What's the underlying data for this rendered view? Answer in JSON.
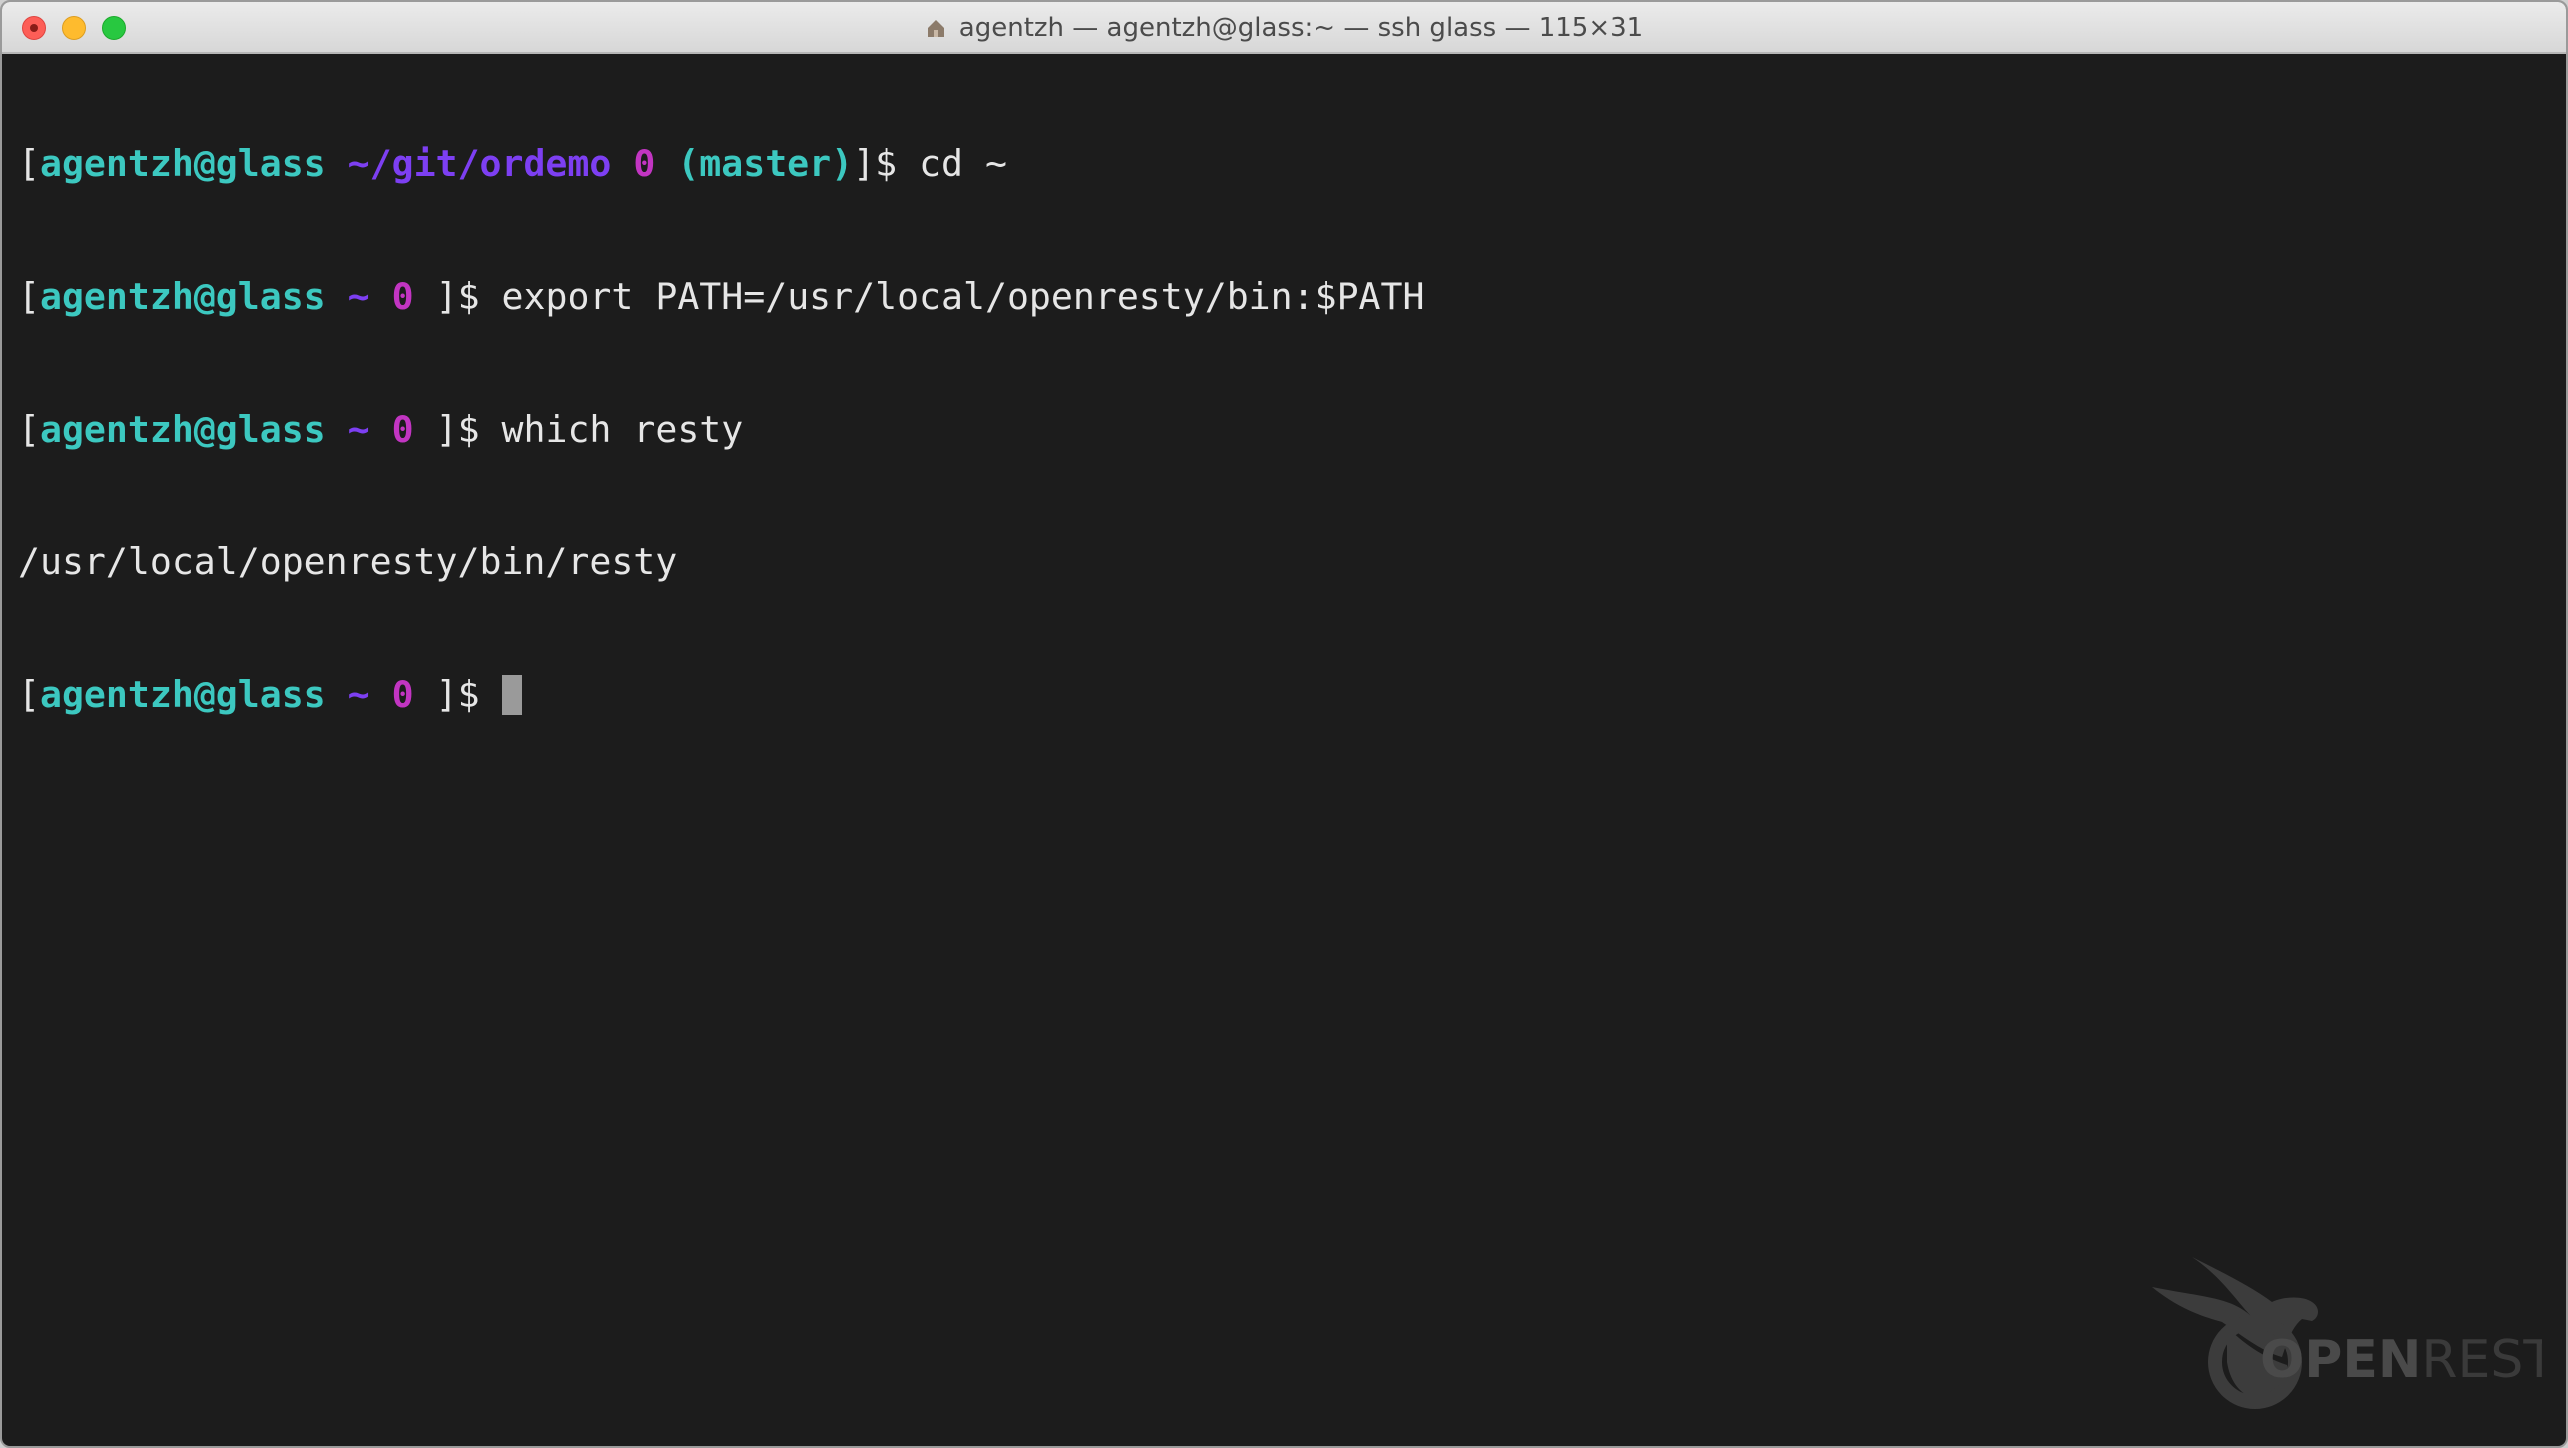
{
  "window": {
    "title": "agentzh — agentzh@glass:~ — ssh glass — 115×31"
  },
  "terminal": {
    "lines": [
      {
        "type": "prompt",
        "open": "[",
        "user": "agentzh@glass",
        "path": "~/git/ordemo",
        "status": "0",
        "branch": "(master)",
        "close": "]$",
        "command": "cd ~"
      },
      {
        "type": "prompt",
        "open": "[",
        "user": "agentzh@glass",
        "path": "~",
        "status": "0",
        "close": "]$",
        "command": "export PATH=/usr/local/openresty/bin:$PATH"
      },
      {
        "type": "prompt",
        "open": "[",
        "user": "agentzh@glass",
        "path": "~",
        "status": "0",
        "close": "]$",
        "command": "which resty"
      },
      {
        "type": "output",
        "text": "/usr/local/openresty/bin/resty"
      },
      {
        "type": "prompt",
        "open": "[",
        "user": "agentzh@glass",
        "path": "~",
        "status": "0",
        "close": "]$",
        "command": ""
      }
    ]
  },
  "watermark": {
    "text_a": "OPEN",
    "text_b": "RESTY"
  },
  "colors": {
    "background": "#1c1c1c",
    "user": "#3cc8c0",
    "path": "#7d3ff2",
    "status": "#c235c2",
    "text": "#e6e6e6"
  }
}
